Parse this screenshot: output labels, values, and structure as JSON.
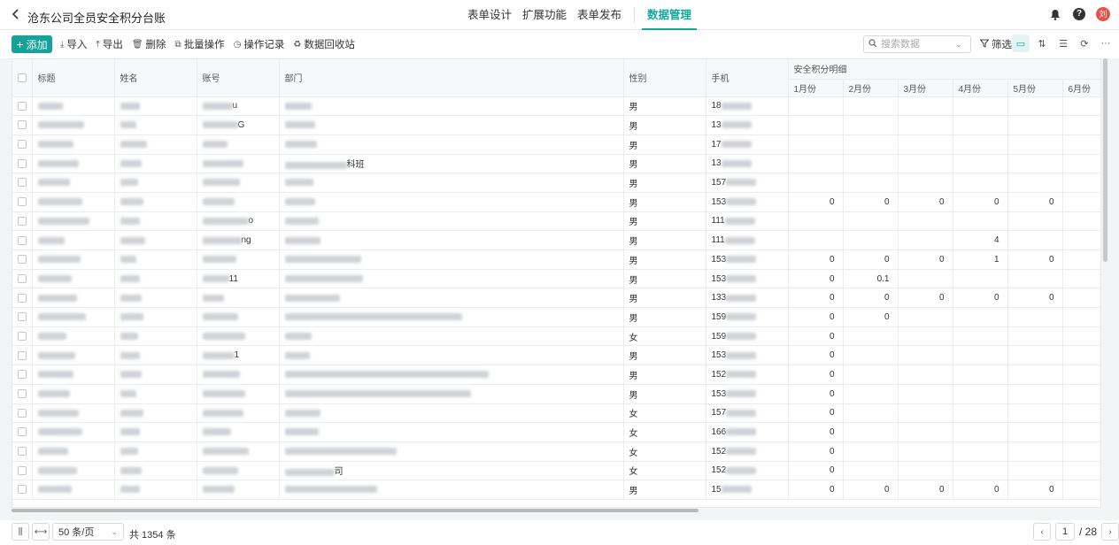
{
  "header": {
    "title": "沧东公司全员安全积分台账",
    "tabs": [
      {
        "label": "表单设计",
        "active": false
      },
      {
        "label": "扩展功能",
        "active": false
      },
      {
        "label": "表单发布",
        "active": false
      },
      {
        "label": "数据管理",
        "active": true
      }
    ],
    "avatar_text": "刘",
    "help_text": "?",
    "accent_color": "#14a39a"
  },
  "toolbar": {
    "add_label": "添加",
    "import_label": "导入",
    "export_label": "导出",
    "delete_label": "删除",
    "batch_label": "批量操作",
    "log_label": "操作记录",
    "recycle_label": "数据回收站",
    "search_placeholder": "搜索数据",
    "filter_label": "筛选"
  },
  "table": {
    "columns": {
      "title": "标题",
      "name": "姓名",
      "account": "账号",
      "dept": "部门",
      "gender": "性别",
      "phone": "手机",
      "group": "安全积分明细",
      "months": [
        "1月份",
        "2月份",
        "3月份",
        "4月份",
        "5月份",
        "6月份"
      ]
    },
    "rows": [
      {
        "title": "",
        "name": "",
        "account": "u",
        "dept": "",
        "gender": "男",
        "phone": "18",
        "months": [
          "",
          "",
          "",
          "",
          "",
          ""
        ]
      },
      {
        "title": "",
        "name": "",
        "account": "G",
        "dept": "",
        "gender": "男",
        "phone": "13",
        "months": [
          "",
          "",
          "",
          "",
          "",
          ""
        ]
      },
      {
        "title": "",
        "name": "",
        "account": "",
        "dept": "",
        "gender": "男",
        "phone": "17",
        "months": [
          "",
          "",
          "",
          "",
          "",
          ""
        ]
      },
      {
        "title": "",
        "name": "",
        "account": "",
        "dept": "科班",
        "gender": "男",
        "phone": "13",
        "months": [
          "",
          "",
          "",
          "",
          "",
          ""
        ]
      },
      {
        "title": "",
        "name": "",
        "account": "",
        "dept": "",
        "gender": "男",
        "phone": "157",
        "months": [
          "",
          "",
          "",
          "",
          "",
          ""
        ]
      },
      {
        "title": "",
        "name": "",
        "account": "",
        "dept": "",
        "gender": "男",
        "phone": "153",
        "months": [
          "0",
          "0",
          "0",
          "0",
          "0",
          ""
        ]
      },
      {
        "title": "",
        "name": "",
        "account": "o",
        "dept": "",
        "gender": "男",
        "phone": "111",
        "months": [
          "",
          "",
          "",
          "",
          "",
          ""
        ]
      },
      {
        "title": "",
        "name": "",
        "account": "ng",
        "dept": "",
        "gender": "男",
        "phone": "111",
        "months": [
          "",
          "",
          "",
          "4",
          "",
          ""
        ]
      },
      {
        "title": "",
        "name": "",
        "account": "",
        "dept": "",
        "gender": "男",
        "phone": "153",
        "months": [
          "0",
          "0",
          "0",
          "1",
          "0",
          ""
        ]
      },
      {
        "title": "",
        "name": "",
        "account": "11",
        "dept": "",
        "gender": "男",
        "phone": "153",
        "months": [
          "0",
          "0.1",
          "",
          "",
          "",
          ""
        ]
      },
      {
        "title": "",
        "name": "",
        "account": "",
        "dept": "",
        "gender": "男",
        "phone": "133",
        "months": [
          "0",
          "0",
          "0",
          "0",
          "0",
          ""
        ]
      },
      {
        "title": "",
        "name": "",
        "account": "",
        "dept": "",
        "gender": "男",
        "phone": "159",
        "months": [
          "0",
          "0",
          "",
          "",
          "",
          ""
        ]
      },
      {
        "title": "",
        "name": "",
        "account": "",
        "dept": "",
        "gender": "女",
        "phone": "159",
        "months": [
          "0",
          "",
          "",
          "",
          "",
          ""
        ]
      },
      {
        "title": "",
        "name": "",
        "account": "1",
        "dept": "",
        "gender": "男",
        "phone": "153",
        "months": [
          "0",
          "",
          "",
          "",
          "",
          ""
        ]
      },
      {
        "title": "",
        "name": "",
        "account": "",
        "dept": "",
        "gender": "男",
        "phone": "152",
        "months": [
          "0",
          "",
          "",
          "",
          "",
          ""
        ]
      },
      {
        "title": "",
        "name": "",
        "account": "",
        "dept": "",
        "gender": "男",
        "phone": "153",
        "months": [
          "0",
          "",
          "",
          "",
          "",
          ""
        ]
      },
      {
        "title": "",
        "name": "",
        "account": "",
        "dept": "",
        "gender": "女",
        "phone": "157",
        "months": [
          "0",
          "",
          "",
          "",
          "",
          ""
        ]
      },
      {
        "title": "",
        "name": "",
        "account": "",
        "dept": "",
        "gender": "女",
        "phone": "166",
        "months": [
          "0",
          "",
          "",
          "",
          "",
          ""
        ]
      },
      {
        "title": "",
        "name": "",
        "account": "",
        "dept": "",
        "gender": "女",
        "phone": "152",
        "months": [
          "0",
          "",
          "",
          "",
          "",
          ""
        ]
      },
      {
        "title": "",
        "name": "",
        "account": "",
        "dept": "司",
        "gender": "女",
        "phone": "152",
        "months": [
          "0",
          "",
          "",
          "",
          "",
          ""
        ]
      },
      {
        "title": "",
        "name": "",
        "account": "",
        "dept": "",
        "gender": "男",
        "phone": "15",
        "months": [
          "0",
          "0",
          "0",
          "0",
          "0",
          ""
        ]
      }
    ]
  },
  "footer": {
    "page_size": "50 条/页",
    "total": "共 1354 条",
    "current_page": "1",
    "total_pages": "/ 28"
  }
}
